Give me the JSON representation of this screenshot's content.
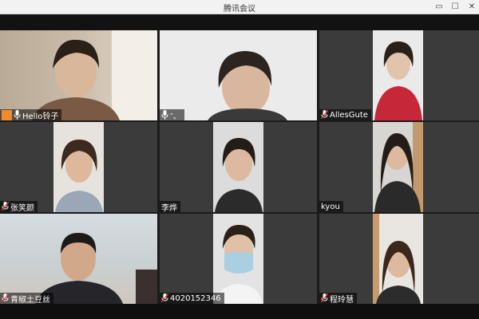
{
  "window": {
    "title": "腾讯会议",
    "controls": {
      "minimize": "▭",
      "maximize": "☐",
      "close": "✕"
    }
  },
  "participants": [
    {
      "name": "Hello铃子",
      "host": true
    },
    {
      "name": "″、",
      "host": false
    },
    {
      "name": "AllesGute",
      "host": false
    },
    {
      "name": "张笑颜",
      "host": false
    },
    {
      "name": "李烨",
      "host": false
    },
    {
      "name": "kyou",
      "host": false
    },
    {
      "name": "青椒土豆丝",
      "host": false
    },
    {
      "name": "4020152346",
      "host": false
    },
    {
      "name": "程玲慧",
      "host": false
    }
  ],
  "colors": {
    "tile_bg": "#3b3b3b",
    "host_badge": "#f08a2b"
  },
  "icons": {
    "mic": "microphone-icon",
    "muted": "mic-muted-icon",
    "host": "host-badge-icon"
  }
}
